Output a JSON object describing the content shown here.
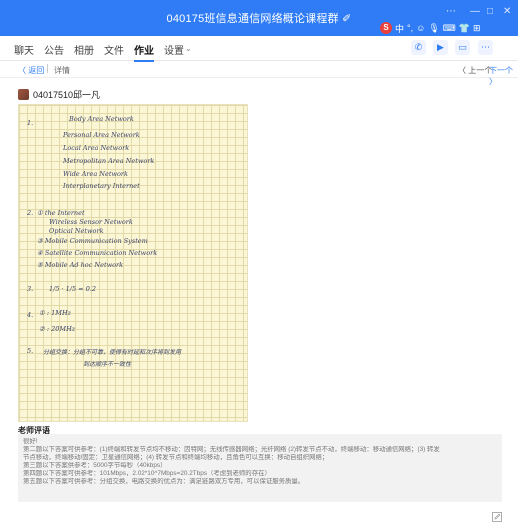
{
  "window": {
    "title": "040175班信息通信网络概论课程群 ✐",
    "controls": [
      "⋯",
      "—",
      "□",
      "✕"
    ]
  },
  "ime_tray": {
    "logo": "S",
    "items": [
      "中",
      "°,",
      "☺",
      "🎙",
      "⌨",
      "👕",
      "⊞"
    ]
  },
  "tabs": [
    "聊天",
    "公告",
    "相册",
    "文件",
    "作业",
    "设置"
  ],
  "active_tab_index": 4,
  "header_icons": [
    "phone-icon",
    "video-icon",
    "screen-share-icon",
    "more-icon"
  ],
  "breadcrumb": {
    "back": "〈 返回",
    "detail": "详情",
    "prev": "〈 上一个",
    "next": "下一个 〉"
  },
  "student": {
    "name": "04017510邱一凡"
  },
  "homework": {
    "q1_num": "1.",
    "q1_lines": [
      "Body Area Network",
      "Personal Area Network",
      "Local Area Network",
      "Metropolitan Area Network",
      "Wide Area Network",
      "Interplanetary Internet"
    ],
    "q2_num": "2.",
    "q2_lines": [
      "① the Internet",
      "Wireless Sensor Network",
      "Optical Network",
      "③ Mobile Communication System",
      "④ Satellite Communication Network",
      "⑤ Mobile Ad hoc Network"
    ],
    "q3_num": "3.",
    "q3_expr": "1/5 · 1/5 ≈ 0.2",
    "q4_num": "4.",
    "q4_line1": "① : 1MHz",
    "q4_line2": "② : 20MHz",
    "q5_num": "5.",
    "q5_line1": "分组交换：分组不可靠，使得有时延和次序将到发用",
    "q5_line2": "到达顺序不一致性"
  },
  "comments": {
    "title": "老师评语",
    "lines": [
      "很好!",
      "第二题以下答案可供参考：(1)终端和转发节点均不移动：因特网；无线传感器网络；光纤网络 (2)转发节点不动，终端移动：移动通信网络；(3) 转发",
      "节点移动，终端移动/固定：卫星通信网络；(4) 转发节点和终端均移动，且角色可以互换：移动自组织网络；",
      "第三题以下答案供参考：5000字节每秒（40kbps）",
      "第四题以下答案可供参考：101Mbps，2.02*10^7Mbps=20.2Tbps（考虑到老师的存在）",
      "第五题以下答案可供参考：分组交换，电路交换的优点为：满足链路双方专用，可以保证服务质量。"
    ]
  },
  "colors": {
    "title_bar": "#2f7cf6",
    "accent": "#2f7cf6",
    "paper": "#fbf6d6",
    "ink": "#3a4468"
  }
}
